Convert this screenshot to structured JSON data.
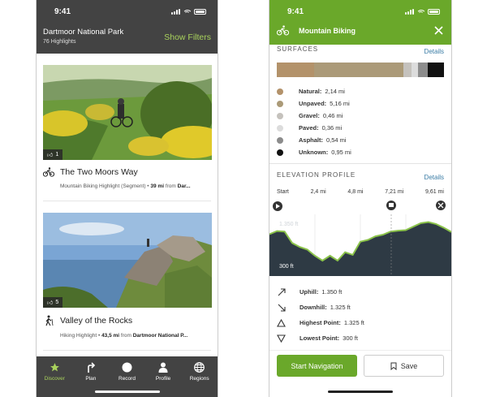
{
  "left_phone": {
    "status_time": "9:41",
    "header": {
      "title": "Dartmoor National Park",
      "subtitle": "76 Highlights",
      "filters_label": "Show Filters"
    },
    "cards": [
      {
        "likes": "1",
        "sport_icon": "mountain-bike-icon",
        "title": "The Two Moors Way",
        "meta_type": "Mountain Biking Highlight (Segment)",
        "meta_distance": "39 mi",
        "meta_from": "from",
        "meta_place": "Dar..."
      },
      {
        "likes": "5",
        "sport_icon": "hiking-icon",
        "title": "Valley of the Rocks",
        "meta_type": "Hiking Highlight",
        "meta_distance": "43,5 mi",
        "meta_from": "from",
        "meta_place": "Dartmoor National P..."
      }
    ],
    "tabs": [
      {
        "label": "Discover",
        "icon": "star-icon",
        "active": true
      },
      {
        "label": "Plan",
        "icon": "route-arrow-icon",
        "active": false
      },
      {
        "label": "Record",
        "icon": "record-dot-icon",
        "active": false
      },
      {
        "label": "Profile",
        "icon": "person-icon",
        "active": false
      },
      {
        "label": "Regions",
        "icon": "globe-icon",
        "active": false
      }
    ]
  },
  "right_phone": {
    "status_time": "9:41",
    "header": {
      "title": "Mountain Biking",
      "sport_icon": "mountain-bike-icon",
      "close_icon": "close-icon"
    },
    "surfaces": {
      "heading": "SURFACES",
      "details_label": "Details",
      "items": [
        {
          "name": "Natural:",
          "value": "2,14 mi",
          "color": "#b3926a",
          "share": 2.14
        },
        {
          "name": "Unpaved:",
          "value": "5,16 mi",
          "color": "#ab9a78",
          "share": 5.16
        },
        {
          "name": "Gravel:",
          "value": "0,46 mi",
          "color": "#c5c2bd",
          "share": 0.46
        },
        {
          "name": "Paved:",
          "value": "0,36 mi",
          "color": "#dcdcdc",
          "share": 0.36
        },
        {
          "name": "Asphalt:",
          "value": "0,54 mi",
          "color": "#8c8c8c",
          "share": 0.54
        },
        {
          "name": "Unknown:",
          "value": "0,95 mi",
          "color": "#111111",
          "share": 0.95
        }
      ]
    },
    "elevation": {
      "heading": "ELEVATION PROFILE",
      "details_label": "Details",
      "ticks": [
        "Start",
        "2,4 mi",
        "4,8 mi",
        "7,21 mi",
        "9,61 mi"
      ],
      "y_top_label": "1.350 ft",
      "y_bottom_label": "300 ft"
    },
    "chart_data": {
      "type": "area",
      "x": [
        0,
        0.4,
        0.8,
        1.2,
        1.6,
        2.0,
        2.4,
        2.8,
        3.2,
        3.6,
        4.0,
        4.4,
        4.8,
        5.2,
        5.6,
        6.0,
        6.4,
        6.8,
        7.2,
        7.6,
        8.0,
        8.4,
        8.8,
        9.2,
        9.61
      ],
      "y": [
        1050,
        1120,
        1110,
        850,
        760,
        700,
        560,
        450,
        560,
        450,
        640,
        580,
        880,
        920,
        1000,
        1040,
        1110,
        1130,
        1140,
        1220,
        1300,
        1325,
        1280,
        1200,
        1100
      ],
      "xlabel": "",
      "ylabel": "",
      "ylim": [
        100,
        1500
      ],
      "grid": true
    },
    "stats": [
      {
        "icon": "uphill-arrow-icon",
        "label": "Uphill:",
        "value": "1.350 ft"
      },
      {
        "icon": "downhill-arrow-icon",
        "label": "Downhill:",
        "value": "1.325 ft"
      },
      {
        "icon": "triangle-up-icon",
        "label": "Highest Point:",
        "value": "1.325 ft"
      },
      {
        "icon": "triangle-down-icon",
        "label": "Lowest Point:",
        "value": "300 ft"
      }
    ],
    "footer": {
      "start_label": "Start Navigation",
      "save_label": "Save"
    }
  }
}
